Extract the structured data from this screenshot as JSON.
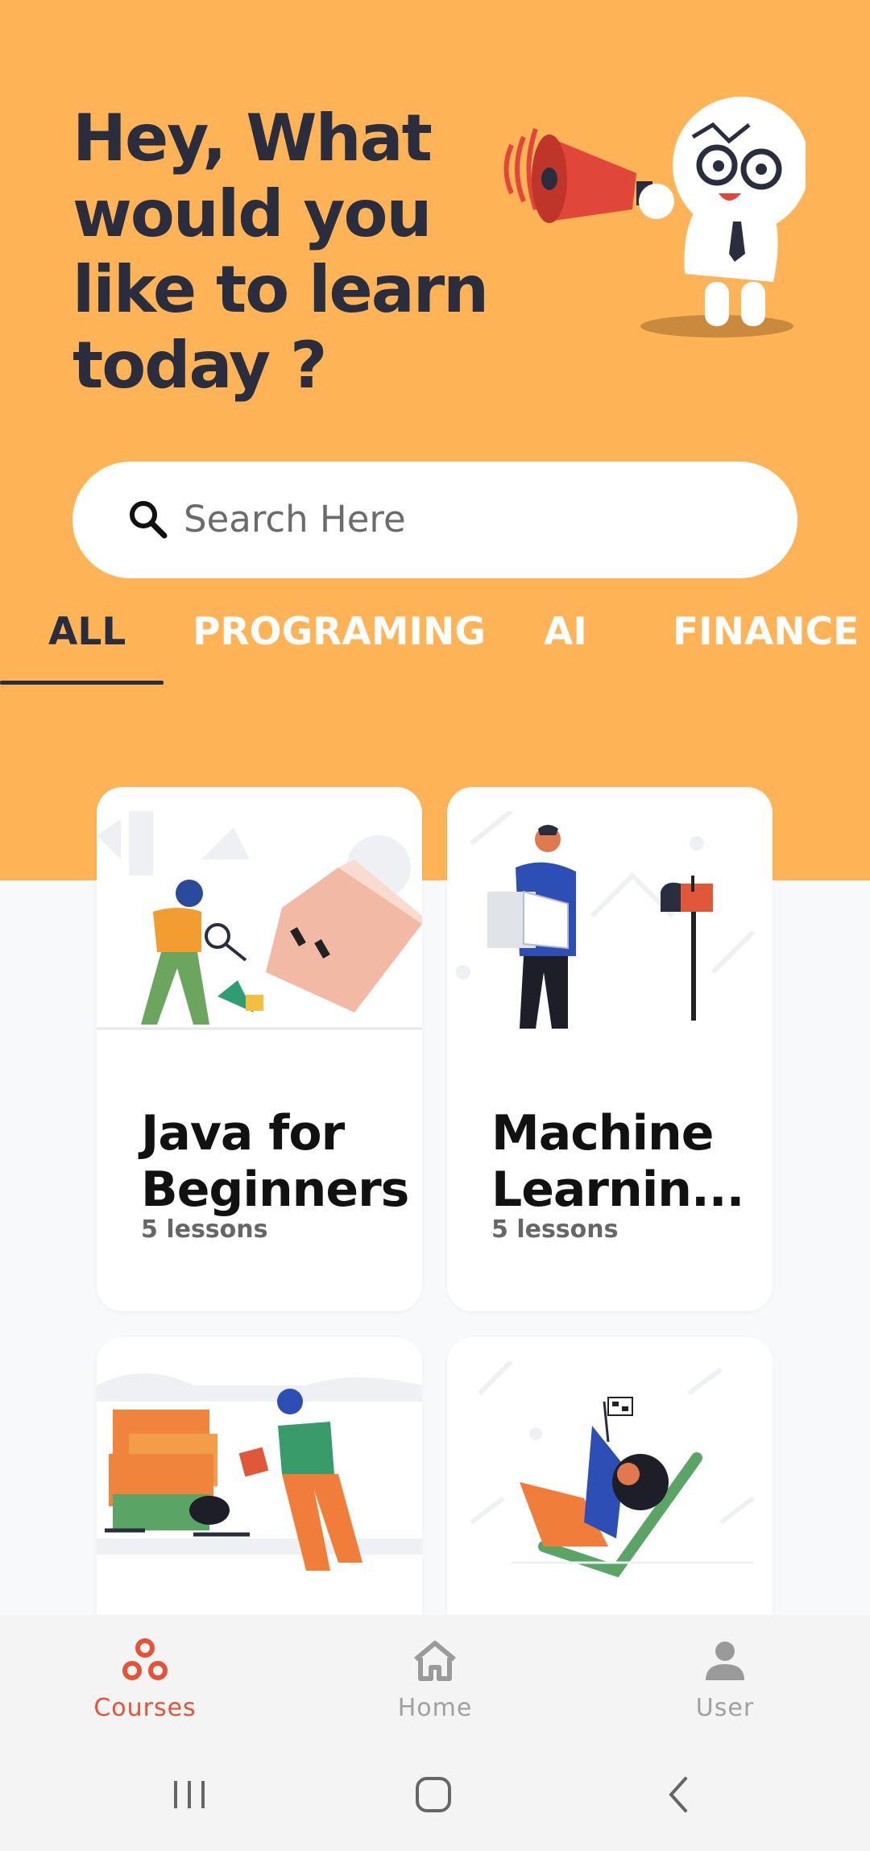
{
  "hero": {
    "headline": "Hey, What would you like to learn today ?"
  },
  "search": {
    "placeholder": "Search Here",
    "icon": "search-icon"
  },
  "tabs": [
    {
      "label": "ALL",
      "active": true
    },
    {
      "label": "PROGRAMING",
      "active": false
    },
    {
      "label": "AI",
      "active": false
    },
    {
      "label": "FINANCE",
      "active": false
    }
  ],
  "courses": [
    {
      "title": "Java for Beginners",
      "lessons": "5 lessons"
    },
    {
      "title": "Machine Learnin...",
      "lessons": "5 lessons"
    },
    {
      "title": "",
      "lessons": ""
    },
    {
      "title": "",
      "lessons": ""
    }
  ],
  "bottom_nav": [
    {
      "label": "Courses",
      "icon": "courses-icon",
      "active": true
    },
    {
      "label": "Home",
      "icon": "home-icon",
      "active": false
    },
    {
      "label": "User",
      "icon": "user-icon",
      "active": false
    }
  ],
  "colors": {
    "hero_bg": "#fdb356",
    "dark_text": "#2a2d3e",
    "accent": "#e55236"
  }
}
